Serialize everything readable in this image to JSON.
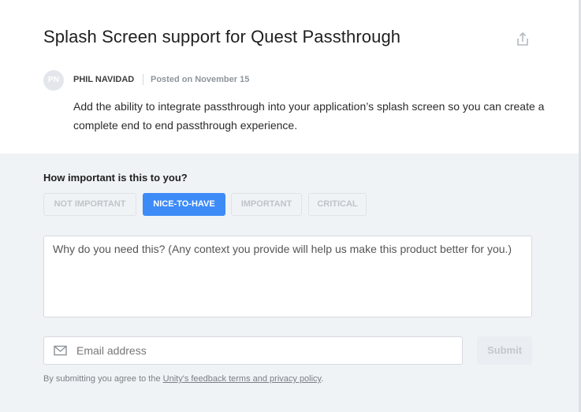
{
  "idea": {
    "title": "Splash Screen support for Quest Passthrough",
    "author_initials": "PN",
    "author_name": "PHIL NAVIDAD",
    "posted": "Posted on November 15",
    "description": "Add the ability to integrate passthrough into your application’s splash screen so you can create a complete end to end passthrough experience."
  },
  "feedback": {
    "importance_label": "How important is this to you?",
    "options": [
      "NOT IMPORTANT",
      "NICE-TO-HAVE",
      "IMPORTANT",
      "CRITICAL"
    ],
    "selected_option": "NICE-TO-HAVE",
    "reason_placeholder": "Why do you need this? (Any context you provide will help us make this product better for you.)",
    "email_placeholder": "Email address",
    "submit_label": "Submit",
    "terms_prefix": "By submitting you agree to the ",
    "terms_link": "Unity's feedback terms and privacy policy",
    "terms_suffix": "."
  },
  "icons": {
    "share": "share-icon",
    "email": "mail-icon"
  },
  "colors": {
    "accent": "#3d8bf7",
    "panel_bg": "#f0f3f6"
  }
}
